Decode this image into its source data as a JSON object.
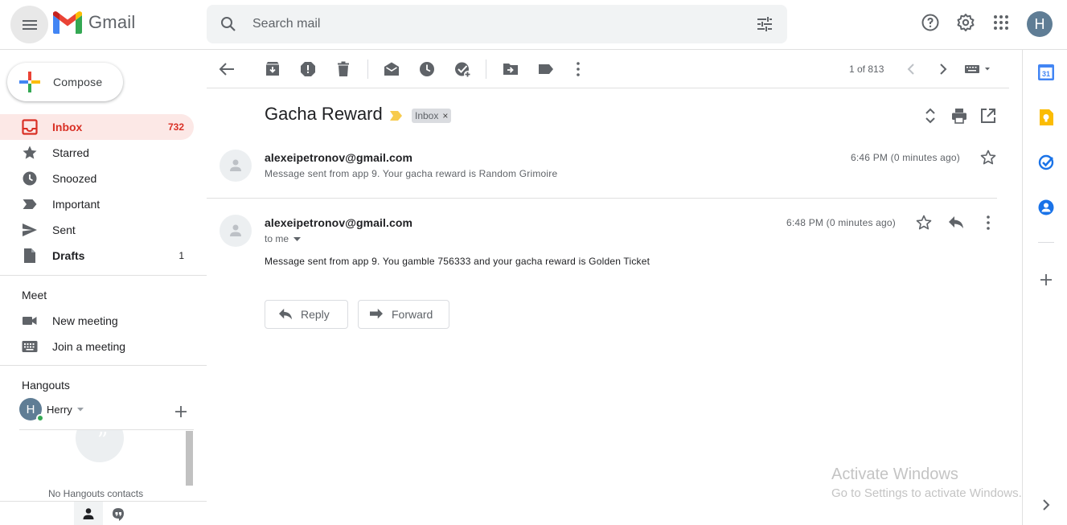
{
  "app": {
    "logo_text": "Gmail"
  },
  "search": {
    "placeholder": "Search mail"
  },
  "header": {
    "account_initial": "H"
  },
  "compose": {
    "label": "Compose"
  },
  "nav": [
    {
      "label": "Inbox",
      "count": "732",
      "icon": "inbox-icon"
    },
    {
      "label": "Starred",
      "count": "",
      "icon": "star-icon"
    },
    {
      "label": "Snoozed",
      "count": "",
      "icon": "clock-icon"
    },
    {
      "label": "Important",
      "count": "",
      "icon": "label-important-icon"
    },
    {
      "label": "Sent",
      "count": "",
      "icon": "send-icon"
    },
    {
      "label": "Drafts",
      "count": "1",
      "icon": "draft-icon"
    }
  ],
  "meet": {
    "title": "Meet",
    "items": [
      {
        "label": "New meeting",
        "icon": "video-icon"
      },
      {
        "label": "Join a meeting",
        "icon": "keyboard-icon"
      }
    ]
  },
  "hangouts": {
    "title": "Hangouts",
    "user_initial": "H",
    "user_name": "Herry",
    "bubble_glyph": "”",
    "empty_text": "No Hangouts contacts"
  },
  "toolbar": {
    "page_count": "1 of 813"
  },
  "thread": {
    "subject": "Gacha Reward",
    "tag": "Inbox",
    "tag_close": "×",
    "messages": [
      {
        "sender": "alexeipetronov@gmail.com",
        "snippet": "Message sent from app 9. Your gacha reward is Random Grimoire",
        "time": "6:46 PM (0 minutes ago)"
      },
      {
        "sender": "alexeipetronov@gmail.com",
        "to": "to me",
        "body": "Message sent from app 9. You gamble 756333 and your gacha reward is Golden Ticket",
        "time": "6:48 PM (0 minutes ago)"
      }
    ],
    "reply_label": "Reply",
    "forward_label": "Forward"
  },
  "watermark": {
    "line1": "Activate Windows",
    "line2": "Go to Settings to activate Windows."
  },
  "side_panel": {
    "calendar_day": "31"
  },
  "colors": {
    "accent_red": "#d93025",
    "active_bg": "#fce8e6",
    "icon_gray": "#5f6368",
    "keep_yellow": "#fbbc04",
    "tasks_blue": "#1a73e8"
  }
}
